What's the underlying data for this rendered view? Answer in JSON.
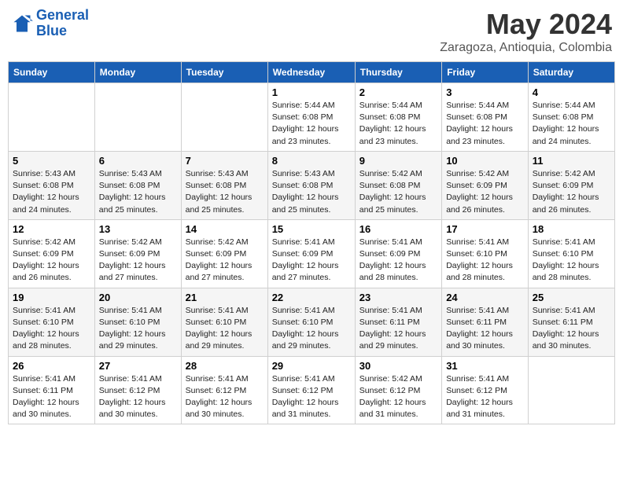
{
  "logo": {
    "line1": "General",
    "line2": "Blue"
  },
  "title": "May 2024",
  "location": "Zaragoza, Antioquia, Colombia",
  "weekdays": [
    "Sunday",
    "Monday",
    "Tuesday",
    "Wednesday",
    "Thursday",
    "Friday",
    "Saturday"
  ],
  "weeks": [
    [
      {
        "day": "",
        "sunrise": "",
        "sunset": "",
        "daylight": ""
      },
      {
        "day": "",
        "sunrise": "",
        "sunset": "",
        "daylight": ""
      },
      {
        "day": "",
        "sunrise": "",
        "sunset": "",
        "daylight": ""
      },
      {
        "day": "1",
        "sunrise": "Sunrise: 5:44 AM",
        "sunset": "Sunset: 6:08 PM",
        "daylight": "Daylight: 12 hours and 23 minutes."
      },
      {
        "day": "2",
        "sunrise": "Sunrise: 5:44 AM",
        "sunset": "Sunset: 6:08 PM",
        "daylight": "Daylight: 12 hours and 23 minutes."
      },
      {
        "day": "3",
        "sunrise": "Sunrise: 5:44 AM",
        "sunset": "Sunset: 6:08 PM",
        "daylight": "Daylight: 12 hours and 23 minutes."
      },
      {
        "day": "4",
        "sunrise": "Sunrise: 5:44 AM",
        "sunset": "Sunset: 6:08 PM",
        "daylight": "Daylight: 12 hours and 24 minutes."
      }
    ],
    [
      {
        "day": "5",
        "sunrise": "Sunrise: 5:43 AM",
        "sunset": "Sunset: 6:08 PM",
        "daylight": "Daylight: 12 hours and 24 minutes."
      },
      {
        "day": "6",
        "sunrise": "Sunrise: 5:43 AM",
        "sunset": "Sunset: 6:08 PM",
        "daylight": "Daylight: 12 hours and 25 minutes."
      },
      {
        "day": "7",
        "sunrise": "Sunrise: 5:43 AM",
        "sunset": "Sunset: 6:08 PM",
        "daylight": "Daylight: 12 hours and 25 minutes."
      },
      {
        "day": "8",
        "sunrise": "Sunrise: 5:43 AM",
        "sunset": "Sunset: 6:08 PM",
        "daylight": "Daylight: 12 hours and 25 minutes."
      },
      {
        "day": "9",
        "sunrise": "Sunrise: 5:42 AM",
        "sunset": "Sunset: 6:08 PM",
        "daylight": "Daylight: 12 hours and 25 minutes."
      },
      {
        "day": "10",
        "sunrise": "Sunrise: 5:42 AM",
        "sunset": "Sunset: 6:09 PM",
        "daylight": "Daylight: 12 hours and 26 minutes."
      },
      {
        "day": "11",
        "sunrise": "Sunrise: 5:42 AM",
        "sunset": "Sunset: 6:09 PM",
        "daylight": "Daylight: 12 hours and 26 minutes."
      }
    ],
    [
      {
        "day": "12",
        "sunrise": "Sunrise: 5:42 AM",
        "sunset": "Sunset: 6:09 PM",
        "daylight": "Daylight: 12 hours and 26 minutes."
      },
      {
        "day": "13",
        "sunrise": "Sunrise: 5:42 AM",
        "sunset": "Sunset: 6:09 PM",
        "daylight": "Daylight: 12 hours and 27 minutes."
      },
      {
        "day": "14",
        "sunrise": "Sunrise: 5:42 AM",
        "sunset": "Sunset: 6:09 PM",
        "daylight": "Daylight: 12 hours and 27 minutes."
      },
      {
        "day": "15",
        "sunrise": "Sunrise: 5:41 AM",
        "sunset": "Sunset: 6:09 PM",
        "daylight": "Daylight: 12 hours and 27 minutes."
      },
      {
        "day": "16",
        "sunrise": "Sunrise: 5:41 AM",
        "sunset": "Sunset: 6:09 PM",
        "daylight": "Daylight: 12 hours and 28 minutes."
      },
      {
        "day": "17",
        "sunrise": "Sunrise: 5:41 AM",
        "sunset": "Sunset: 6:10 PM",
        "daylight": "Daylight: 12 hours and 28 minutes."
      },
      {
        "day": "18",
        "sunrise": "Sunrise: 5:41 AM",
        "sunset": "Sunset: 6:10 PM",
        "daylight": "Daylight: 12 hours and 28 minutes."
      }
    ],
    [
      {
        "day": "19",
        "sunrise": "Sunrise: 5:41 AM",
        "sunset": "Sunset: 6:10 PM",
        "daylight": "Daylight: 12 hours and 28 minutes."
      },
      {
        "day": "20",
        "sunrise": "Sunrise: 5:41 AM",
        "sunset": "Sunset: 6:10 PM",
        "daylight": "Daylight: 12 hours and 29 minutes."
      },
      {
        "day": "21",
        "sunrise": "Sunrise: 5:41 AM",
        "sunset": "Sunset: 6:10 PM",
        "daylight": "Daylight: 12 hours and 29 minutes."
      },
      {
        "day": "22",
        "sunrise": "Sunrise: 5:41 AM",
        "sunset": "Sunset: 6:10 PM",
        "daylight": "Daylight: 12 hours and 29 minutes."
      },
      {
        "day": "23",
        "sunrise": "Sunrise: 5:41 AM",
        "sunset": "Sunset: 6:11 PM",
        "daylight": "Daylight: 12 hours and 29 minutes."
      },
      {
        "day": "24",
        "sunrise": "Sunrise: 5:41 AM",
        "sunset": "Sunset: 6:11 PM",
        "daylight": "Daylight: 12 hours and 30 minutes."
      },
      {
        "day": "25",
        "sunrise": "Sunrise: 5:41 AM",
        "sunset": "Sunset: 6:11 PM",
        "daylight": "Daylight: 12 hours and 30 minutes."
      }
    ],
    [
      {
        "day": "26",
        "sunrise": "Sunrise: 5:41 AM",
        "sunset": "Sunset: 6:11 PM",
        "daylight": "Daylight: 12 hours and 30 minutes."
      },
      {
        "day": "27",
        "sunrise": "Sunrise: 5:41 AM",
        "sunset": "Sunset: 6:12 PM",
        "daylight": "Daylight: 12 hours and 30 minutes."
      },
      {
        "day": "28",
        "sunrise": "Sunrise: 5:41 AM",
        "sunset": "Sunset: 6:12 PM",
        "daylight": "Daylight: 12 hours and 30 minutes."
      },
      {
        "day": "29",
        "sunrise": "Sunrise: 5:41 AM",
        "sunset": "Sunset: 6:12 PM",
        "daylight": "Daylight: 12 hours and 31 minutes."
      },
      {
        "day": "30",
        "sunrise": "Sunrise: 5:42 AM",
        "sunset": "Sunset: 6:12 PM",
        "daylight": "Daylight: 12 hours and 31 minutes."
      },
      {
        "day": "31",
        "sunrise": "Sunrise: 5:41 AM",
        "sunset": "Sunset: 6:12 PM",
        "daylight": "Daylight: 12 hours and 31 minutes."
      },
      {
        "day": "",
        "sunrise": "",
        "sunset": "",
        "daylight": ""
      }
    ]
  ]
}
